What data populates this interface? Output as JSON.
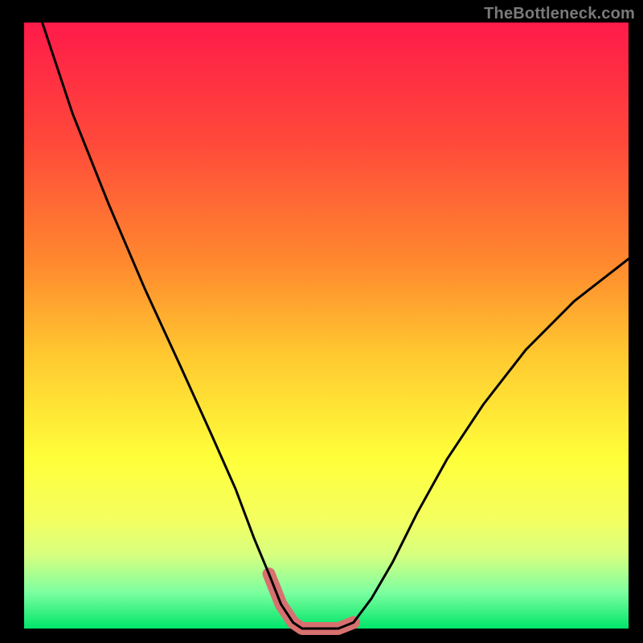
{
  "watermark": "TheBottleneck.com",
  "chart_data": {
    "type": "line",
    "title": "",
    "xlabel": "",
    "ylabel": "",
    "xlim": [
      0,
      100
    ],
    "ylim": [
      0,
      100
    ],
    "series": [
      {
        "name": "curve",
        "x": [
          3,
          8,
          14,
          20,
          26,
          31,
          35,
          38,
          40.5,
          42.5,
          44.5,
          46,
          48,
          50,
          52,
          54.5,
          57.5,
          61,
          65,
          70,
          76,
          83,
          91,
          100
        ],
        "y": [
          100,
          85,
          70,
          56,
          43,
          32,
          23,
          15,
          9,
          4,
          1,
          0,
          0,
          0,
          0,
          1,
          5,
          11,
          19,
          28,
          37,
          46,
          54,
          61
        ]
      }
    ],
    "highlight_range_x": [
      40.5,
      55.5
    ],
    "background_gradient": {
      "stops": [
        {
          "offset": 0.0,
          "color": "#ff1a4a"
        },
        {
          "offset": 0.2,
          "color": "#ff4a3a"
        },
        {
          "offset": 0.4,
          "color": "#ff8a2e"
        },
        {
          "offset": 0.55,
          "color": "#ffc930"
        },
        {
          "offset": 0.72,
          "color": "#ffff3a"
        },
        {
          "offset": 0.82,
          "color": "#f4ff60"
        },
        {
          "offset": 0.88,
          "color": "#d6ff80"
        },
        {
          "offset": 0.94,
          "color": "#7dffa0"
        },
        {
          "offset": 1.0,
          "color": "#00e56a"
        }
      ]
    },
    "colors": {
      "curve": "#000000",
      "highlight": "#d87070",
      "frame": "#000000"
    }
  }
}
